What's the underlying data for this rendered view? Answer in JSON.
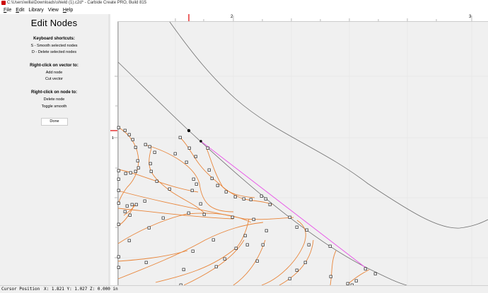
{
  "window": {
    "title": "C:\\Users\\willa\\Downloads\\shield (1).c2d* - Carbide Create PRO, Build 815"
  },
  "menu": [
    {
      "label": "File",
      "key": "F"
    },
    {
      "label": "Edit",
      "key": "E"
    },
    {
      "label": "Library",
      "key": ""
    },
    {
      "label": "View",
      "key": ""
    },
    {
      "label": "Help",
      "key": "H"
    }
  ],
  "panel": {
    "title": "Edit Nodes",
    "keyboard_header": "Keyboard shortcuts:",
    "shortcut_smooth": "S - Smooth selected nodes",
    "shortcut_delete": "D - Delete selected nodes",
    "vector_header": "Right-click on vector to:",
    "vector_add": "Add node",
    "vector_cut": "Cut vector",
    "node_header": "Right-click on node to:",
    "node_delete": "Delete node",
    "node_toggle": "Toggle smooth",
    "done_label": "Done"
  },
  "rulers": {
    "top_labels": [
      "2",
      "3"
    ],
    "left_labels": [
      "1"
    ]
  },
  "status": {
    "label": "Cursor Position",
    "value": "X: 1.821 Y: 1.027 Z: 0.000 in"
  },
  "colors": {
    "accent_path": "#e8853a",
    "selected_segment": "#e85be8",
    "toolpath_line": "#707070",
    "grid": "#e4e4e4",
    "ruler_marker": "#e00000"
  }
}
